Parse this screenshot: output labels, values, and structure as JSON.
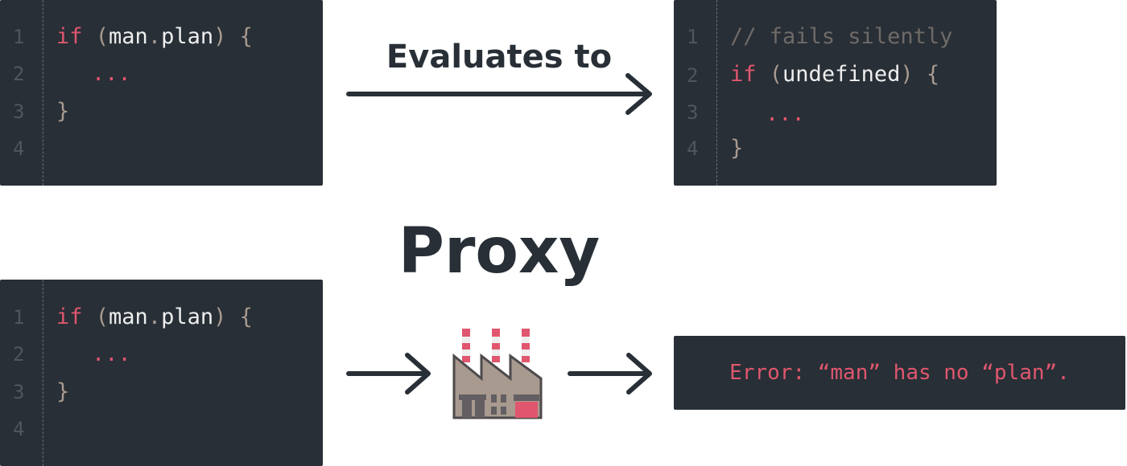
{
  "colors": {
    "code_bg": "#282f36",
    "keyword": "#e0566e",
    "punct": "#a89a8f",
    "text": "#eeeeee"
  },
  "top_left": {
    "line_numbers": [
      "1",
      "2",
      "3",
      "4"
    ],
    "kw": "if",
    "open": "(",
    "ident": "man",
    "dot": ".",
    "prop": "plan",
    "close": ")",
    "brace_open": "{",
    "ellipsis": "...",
    "brace_close": "}"
  },
  "evaluates_label": "Evaluates to",
  "top_right": {
    "line_numbers": [
      "1",
      "2",
      "3",
      "4"
    ],
    "comment": "// fails silently",
    "kw": "if",
    "open": "(",
    "ident": "undefined",
    "close": ")",
    "brace_open": "{",
    "ellipsis": "...",
    "brace_close": "}"
  },
  "proxy_label": "Proxy",
  "bottom_left": {
    "line_numbers": [
      "1",
      "2",
      "3",
      "4"
    ],
    "kw": "if",
    "open": "(",
    "ident": "man",
    "dot": ".",
    "prop": "plan",
    "close": ")",
    "brace_open": "{",
    "ellipsis": "...",
    "brace_close": "}"
  },
  "factory_icon": "factory-icon",
  "error_message": "Error: “man” has no “plan”."
}
